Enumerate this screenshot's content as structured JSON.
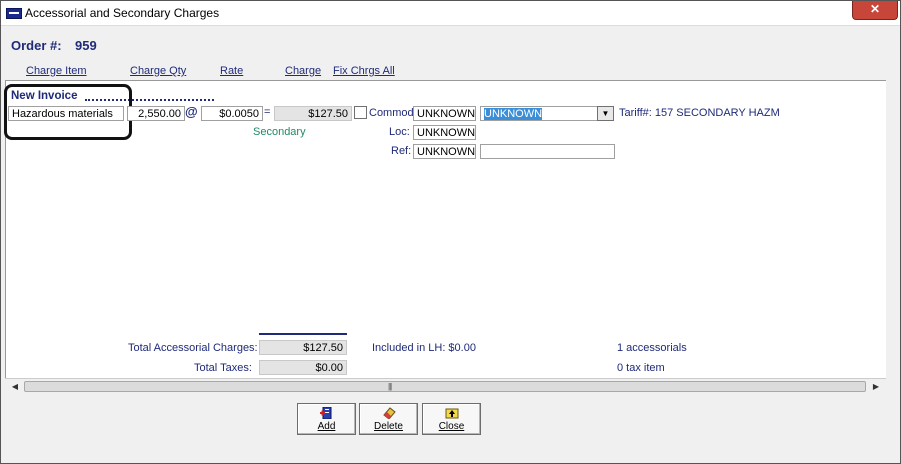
{
  "window": {
    "title": "Accessorial and Secondary Charges",
    "close_glyph": "✕"
  },
  "order": {
    "label": "Order #:",
    "value": "959"
  },
  "columns": {
    "charge_item": "Charge Item",
    "charge_qty": "Charge Qty",
    "rate": "Rate",
    "charge": "Charge",
    "fix_charges_all": "Fix Chrgs All"
  },
  "invoice": {
    "title": "New Invoice",
    "item": "Hazardous materials",
    "qty": "2,550.00",
    "at_sign": "@",
    "rate": "$0.0050",
    "equals": "=",
    "charge": "$127.50",
    "secondary_label": "Secondary",
    "commod_label": "Commod:",
    "commod_code": "UNKNOWN",
    "commod_select": "UNKNOWN",
    "tariff": "Tariff#: 157 SECONDARY HAZM",
    "loc_label": "Loc:",
    "loc_value": "UNKNOWN",
    "ref_label": "Ref:",
    "ref_value": "UNKNOWN",
    "ref_extra": ""
  },
  "totals": {
    "accessorial_label": "Total Accessorial Charges:",
    "accessorial_value": "$127.50",
    "included_lh": "Included in LH: $0.00",
    "accessorials_count": "1 accessorials",
    "taxes_label": "Total Taxes:",
    "taxes_value": "$0.00",
    "tax_items": "0 tax item"
  },
  "buttons": {
    "add": "Add",
    "delete": "Delete",
    "close": "Close"
  },
  "colors": {
    "label_blue": "#1f2a78",
    "secondary_green": "#1f8a6a",
    "selection": "#3a8fd8"
  }
}
